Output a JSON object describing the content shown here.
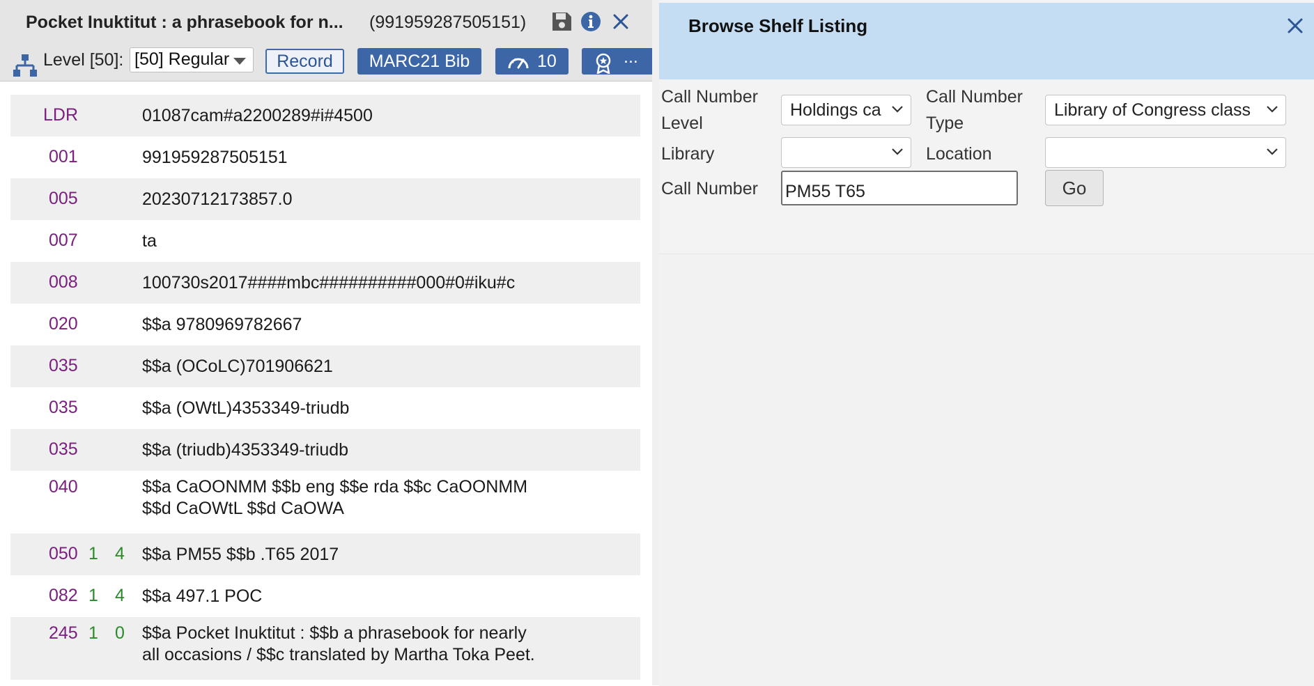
{
  "record": {
    "title": "Pocket Inuktitut : a phrasebook for n...",
    "id": "(991959287505151)"
  },
  "toolbar": {
    "level_label": "Level [50]:",
    "level_value": "[50] Regular",
    "record_label": "Record",
    "marc_label": "MARC21 Bib",
    "speed_value": "10",
    "more_label": "..."
  },
  "marc_fields": [
    {
      "tag": "LDR",
      "ind1": "",
      "ind2": "",
      "lines": [
        "01087cam#a2200289#i#4500"
      ]
    },
    {
      "tag": "001",
      "ind1": "",
      "ind2": "",
      "lines": [
        "991959287505151"
      ]
    },
    {
      "tag": "005",
      "ind1": "",
      "ind2": "",
      "lines": [
        "20230712173857.0"
      ]
    },
    {
      "tag": "007",
      "ind1": "",
      "ind2": "",
      "lines": [
        "ta"
      ]
    },
    {
      "tag": "008",
      "ind1": "",
      "ind2": "",
      "lines": [
        "100730s2017####mbc##########000#0#iku#c"
      ]
    },
    {
      "tag": "020",
      "ind1": "",
      "ind2": "",
      "lines": [
        "$$a 9780969782667"
      ]
    },
    {
      "tag": "035",
      "ind1": "",
      "ind2": "",
      "lines": [
        "$$a (OCoLC)701906621"
      ]
    },
    {
      "tag": "035",
      "ind1": "",
      "ind2": "",
      "lines": [
        "$$a (OWtL)4353349-triudb"
      ]
    },
    {
      "tag": "035",
      "ind1": "",
      "ind2": "",
      "lines": [
        "$$a (triudb)4353349-triudb"
      ]
    },
    {
      "tag": "040",
      "ind1": "",
      "ind2": "",
      "lines": [
        "$$a CaOONMM $$b eng $$e rda $$c CaOONMM",
        "$$d CaOWtL $$d CaOWA"
      ]
    },
    {
      "tag": "050",
      "ind1": "1",
      "ind2": "4",
      "lines": [
        "$$a PM55 $$b .T65 2017"
      ]
    },
    {
      "tag": "082",
      "ind1": "1",
      "ind2": "4",
      "lines": [
        "$$a 497.1 POC"
      ]
    },
    {
      "tag": "245",
      "ind1": "1",
      "ind2": "0",
      "lines": [
        "$$a Pocket Inuktitut : $$b a phrasebook for nearly",
        "all occasions / $$c translated by Martha Toka Peet."
      ]
    }
  ],
  "shelf": {
    "title": "Browse Shelf Listing",
    "call_number_level_label_1": "Call Number",
    "call_number_level_label_2": "Level",
    "call_number_level_value": "Holdings ca",
    "call_number_type_label_1": "Call Number",
    "call_number_type_label_2": "Type",
    "call_number_type_value": "Library of Congress class",
    "library_label": "Library",
    "library_value": "",
    "location_label": "Location",
    "location_value": "",
    "call_number_label": "Call Number",
    "call_number_value": "PM55 T65",
    "go_label": "Go"
  },
  "colors": {
    "tag": "#7a1e7f",
    "indicator": "#2a8a2a",
    "primary_button": "#3d66a6",
    "right_header": "#c5ddf3"
  },
  "icons": [
    "save-icon",
    "info-icon",
    "close-icon",
    "hierarchy-icon",
    "speedometer-icon",
    "award-icon",
    "chevron-down-icon"
  ]
}
